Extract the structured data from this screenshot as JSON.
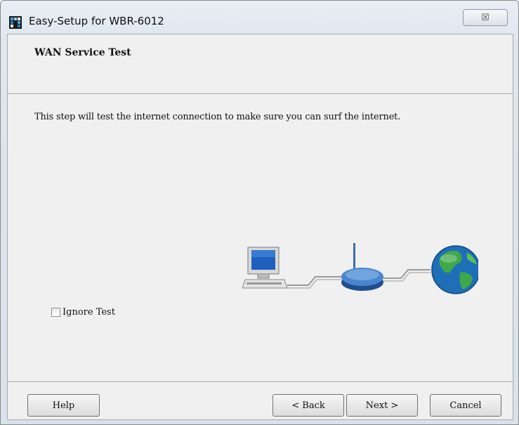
{
  "window": {
    "title": "Easy-Setup for WBR-6012",
    "close_glyph": "☒"
  },
  "header": {
    "title": "WAN Service Test"
  },
  "main": {
    "description": "This step will test the internet connection to make sure you can surf the internet.",
    "illustration": [
      "computer-icon",
      "router-icon",
      "globe-icon"
    ],
    "ignore_test": {
      "label": "Ignore Test",
      "checked": false
    }
  },
  "footer": {
    "help_label": "Help",
    "back_label": "< Back",
    "next_label": "Next >",
    "cancel_label": "Cancel"
  }
}
